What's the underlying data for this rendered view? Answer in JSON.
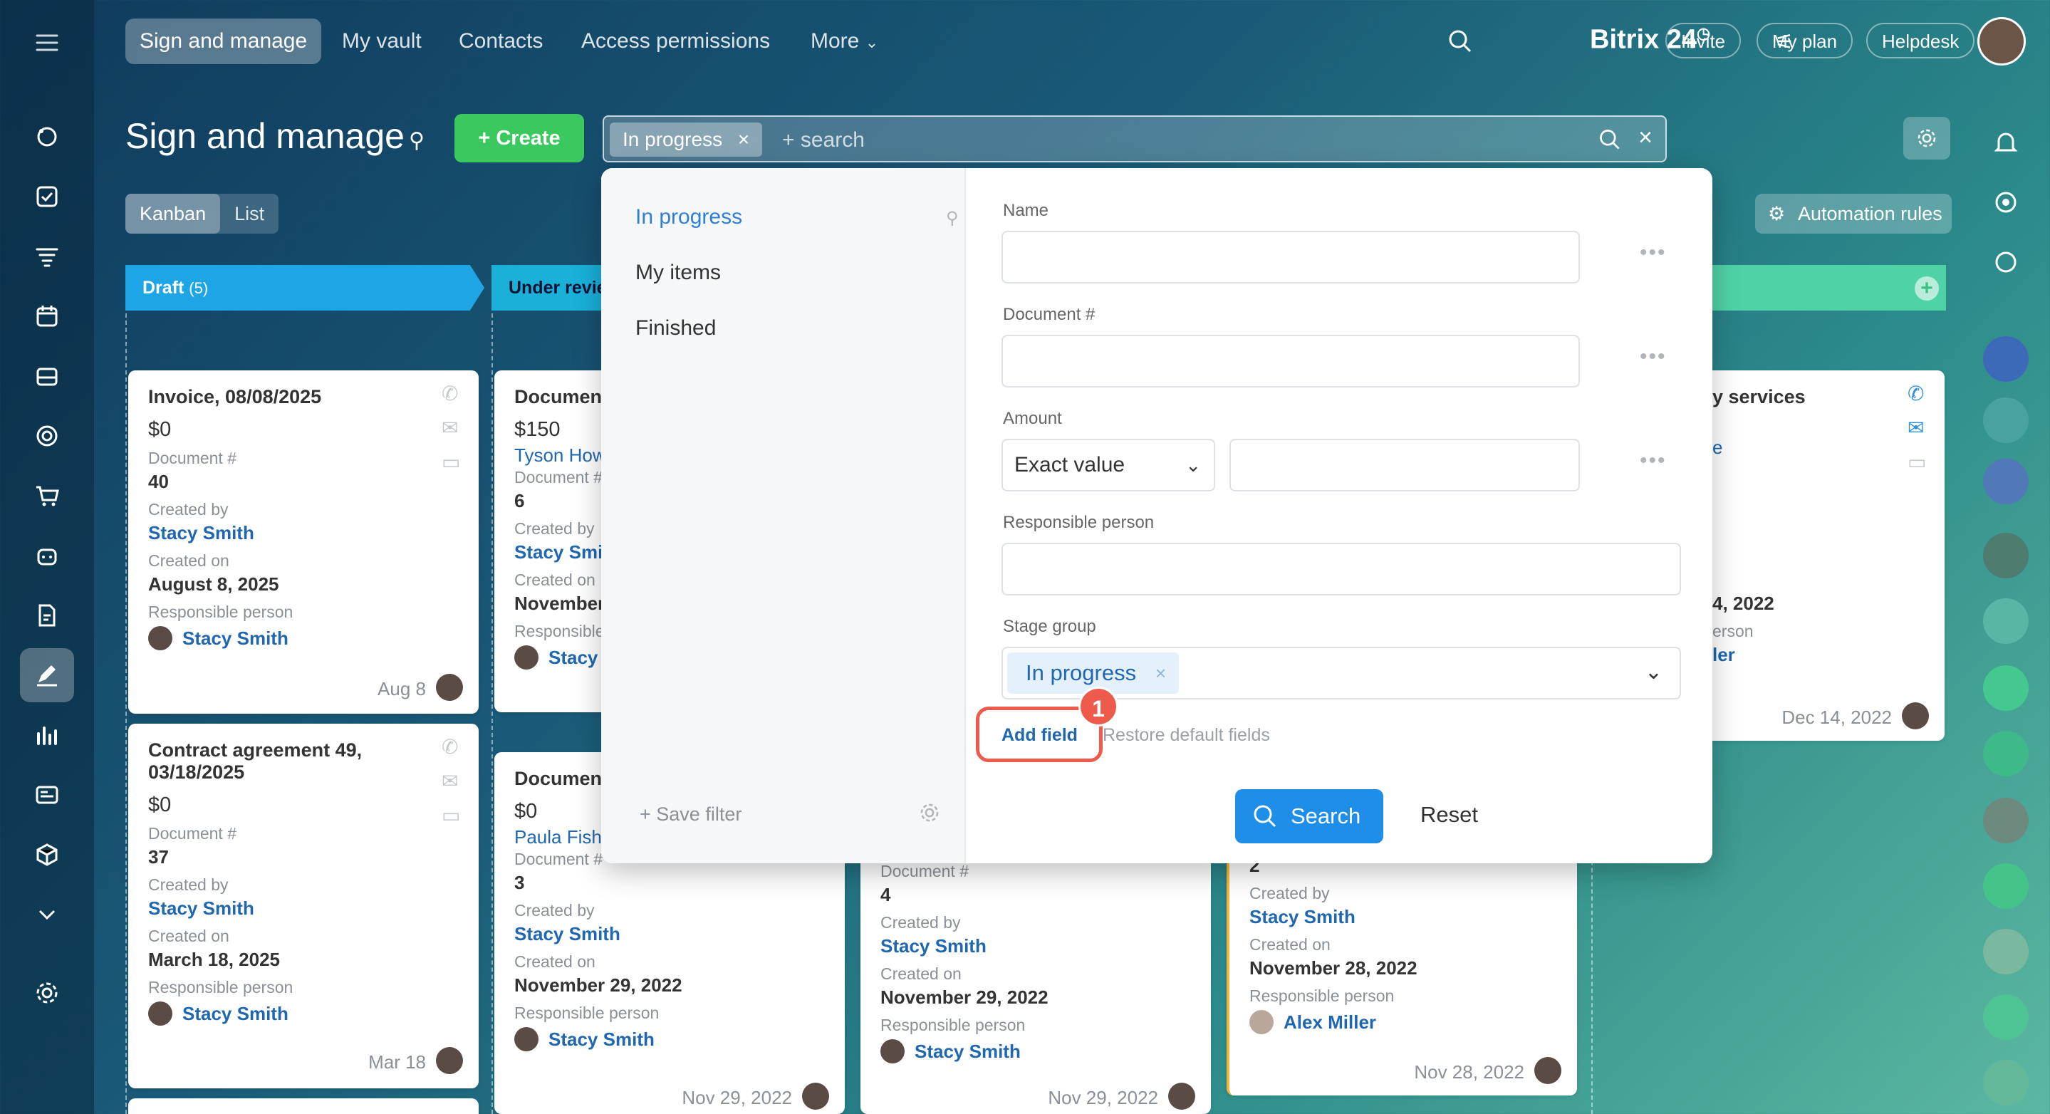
{
  "topnav": {
    "tabs": [
      {
        "label": "Sign and manage"
      },
      {
        "label": "My vault"
      },
      {
        "label": "Contacts"
      },
      {
        "label": "Access permissions"
      },
      {
        "label": "More"
      }
    ],
    "brand": "Bitrix 24",
    "invite": "Invite",
    "my_plan": "My plan",
    "helpdesk": "Helpdesk"
  },
  "page": {
    "title": "Sign and manage",
    "create_label": "Create",
    "view_kanban": "Kanban",
    "view_list": "List",
    "automation_rules": "Automation rules"
  },
  "filter": {
    "chip": "In progress",
    "placeholder": "+ search"
  },
  "columns": [
    {
      "name": "Draft",
      "count": "(5)"
    },
    {
      "name": "Under revie"
    }
  ],
  "cards": [
    {
      "title": "Invoice, 08/08/2025",
      "amount": "$0",
      "doc_label": "Document #",
      "doc_num": "40",
      "created_by_label": "Created by",
      "created_by": "Stacy Smith",
      "created_on_label": "Created on",
      "created_on": "August 8, 2025",
      "resp_label": "Responsible person",
      "resp": "Stacy Smith",
      "date": "Aug 8"
    },
    {
      "title": "Contract agreement 49, 03/18/2025",
      "amount": "$0",
      "doc_label": "Document #",
      "doc_num": "37",
      "created_by_label": "Created by",
      "created_by": "Stacy Smith",
      "created_on_label": "Created on",
      "created_on": "March 18, 2025",
      "resp_label": "Responsible person",
      "resp": "Stacy Smith",
      "date": "Mar 18"
    },
    {
      "title": "Document",
      "amount": "$150",
      "client": "Tyson How",
      "doc_label": "Document #",
      "doc_num": "6",
      "created_by_label": "Created by",
      "created_by": "Stacy Smit",
      "created_on_label": "Created on",
      "created_on": "November",
      "resp_label": "Responsible",
      "resp": "Stacy"
    },
    {
      "title": "Document",
      "amount": "$0",
      "client": "Paula Fish",
      "doc_label": "Document #",
      "doc_num": "3",
      "created_by_label": "Created by",
      "created_by": "Stacy Smith",
      "created_on_label": "Created on",
      "created_on": "November 29, 2022",
      "resp_label": "Responsible person",
      "resp": "Stacy Smith",
      "date": "Nov 29, 2022"
    },
    {
      "doc_label": "Document #",
      "doc_num": "4",
      "created_by_label": "Created by",
      "created_by": "Stacy Smith",
      "created_on_label": "Created on",
      "created_on": "November 29, 2022",
      "resp_label": "Responsible person",
      "resp": "Stacy Smith",
      "date": "Nov 29, 2022"
    },
    {
      "doc_num": "2",
      "created_by_label": "Created by",
      "created_by": "Stacy Smith",
      "created_on_label": "Created on",
      "created_on": "November 28, 2022",
      "resp_label": "Responsible person",
      "resp": "Alex Miller",
      "date": "Nov 28, 2022"
    },
    {
      "title": "y services",
      "client": "e",
      "created_on": "4, 2022",
      "resp_label": "erson",
      "resp": "ler",
      "date": "Dec 14, 2022"
    }
  ],
  "popup": {
    "presets": [
      {
        "label": "In progress"
      },
      {
        "label": "My items"
      },
      {
        "label": "Finished"
      }
    ],
    "save_filter": "Save filter",
    "fields": {
      "name": "Name",
      "document": "Document #",
      "amount": "Amount",
      "amount_mode": "Exact value",
      "responsible": "Responsible person",
      "stage_group": "Stage group",
      "stage_value": "In progress"
    },
    "add_field": "Add field",
    "restore_default": "Restore default fields",
    "callout_number": "1",
    "search_btn": "Search",
    "reset_btn": "Reset"
  }
}
